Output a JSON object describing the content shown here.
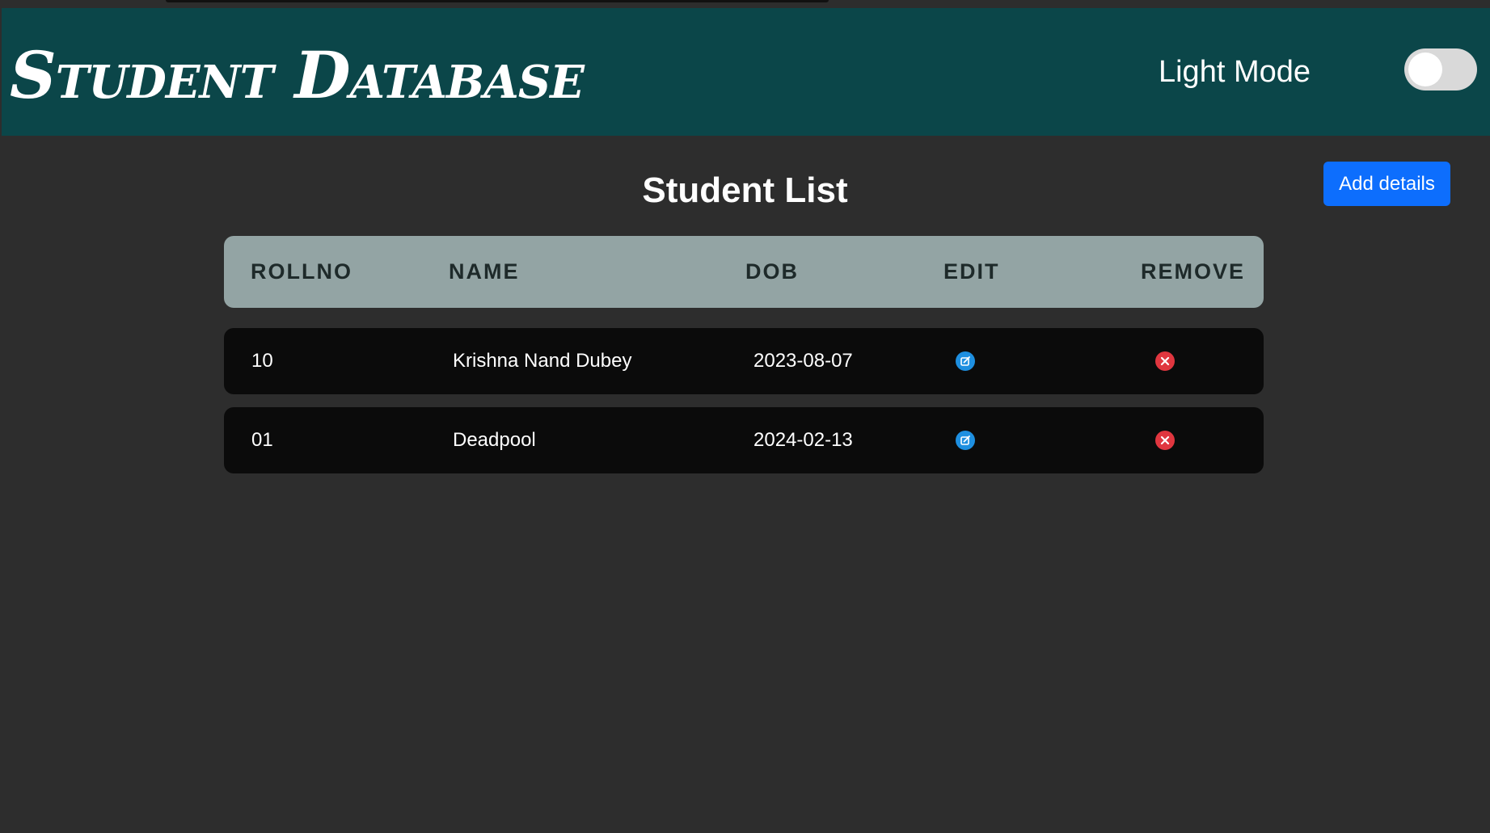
{
  "header": {
    "brand": "Student Database",
    "mode_label": "Light Mode",
    "mode_toggle_on": false
  },
  "main": {
    "title": "Student List",
    "add_button_label": "Add details"
  },
  "table": {
    "columns": [
      "ROLLNO",
      "NAME",
      "DOB",
      "EDIT",
      "REMOVE"
    ],
    "rows": [
      {
        "rollno": "10",
        "name": "Krishna Nand Dubey",
        "dob": "2023-08-07",
        "edit_icon": "edit-icon",
        "remove_icon": "remove-icon"
      },
      {
        "rollno": "01",
        "name": "Deadpool",
        "dob": "2024-02-13",
        "edit_icon": "edit-icon",
        "remove_icon": "remove-icon"
      }
    ]
  },
  "colors": {
    "header_bg": "#0b4649",
    "page_bg": "#2d2d2d",
    "table_head_bg": "#93a4a4",
    "row_bg": "#0b0b0b",
    "primary": "#0d6efd",
    "edit_icon": "#1e8fe0",
    "remove_icon": "#e0363f"
  }
}
